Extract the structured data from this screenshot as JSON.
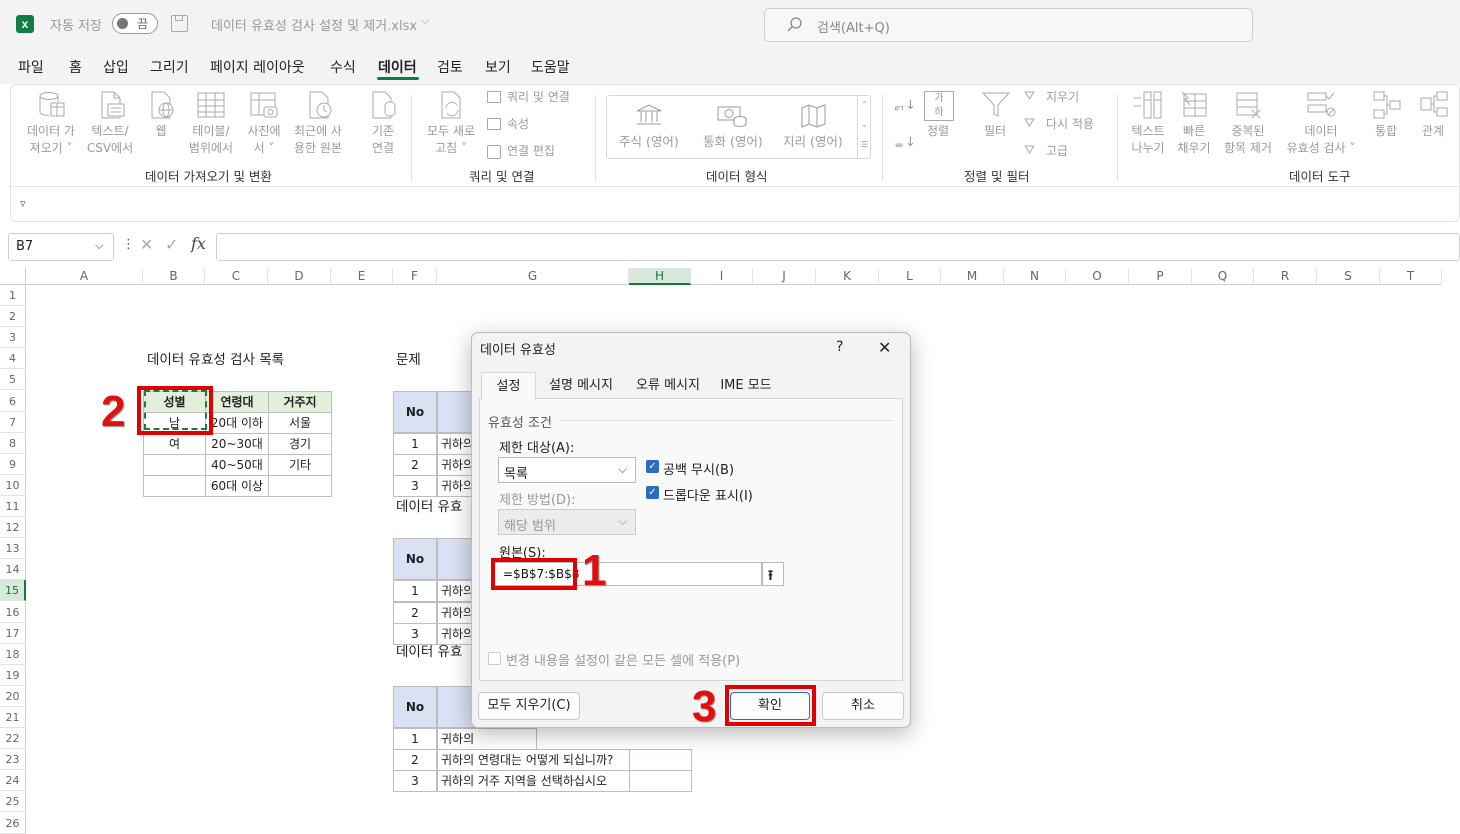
{
  "titlebar": {
    "autosave_label": "자동 저장",
    "toggle_label": "끔",
    "filename": "데이터 유효성 검사 설정 및 제거.xlsx",
    "search_placeholder": "검색(Alt+Q)"
  },
  "menu": [
    "파일",
    "홈",
    "삽입",
    "그리기",
    "페이지 레이아웃",
    "수식",
    "데이터",
    "검토",
    "보기",
    "도움말"
  ],
  "ribbon": {
    "get_data_1": "데이터 가",
    "get_data_2": "져오기 ˅",
    "text_csv_1": "텍스트/",
    "text_csv_2": "CSV에서",
    "web": "웹",
    "table_1": "테이블/",
    "table_2": "범위에서",
    "picture_1": "사진에",
    "picture_2": "서 ˅",
    "recent_1": "최근에 사",
    "recent_2": "용한 원본",
    "existing_1": "기존",
    "existing_2": "연결",
    "refresh_1": "모두 새로",
    "refresh_2": "고침 ˅",
    "queries": "쿼리 및 연결",
    "properties": "속성",
    "edit_links": "연결 편집",
    "stocks": "주식 (영어)",
    "currency": "통화 (영어)",
    "geo": "지리 (영어)",
    "sort": "정렬",
    "filter": "필터",
    "clear": "지우기",
    "reapply": "다시 적용",
    "advanced": "고급",
    "text_col_1": "텍스트",
    "text_col_2": "나누기",
    "flash_1": "빠른",
    "flash_2": "채우기",
    "dup_1": "중복된",
    "dup_2": "항목 제거",
    "valid_1": "데이터",
    "valid_2": "유효성 검사 ˅",
    "consolidate": "통합",
    "relations": "관계",
    "grp_get": "데이터 가져오기 및 변환",
    "grp_query": "쿼리 및 연결",
    "grp_types": "데이터 형식",
    "grp_sort": "정렬 및 필터",
    "grp_tools": "데이터 도구"
  },
  "formula_bar": {
    "name_box": "B7",
    "fx": "fx",
    "value": ""
  },
  "columns": [
    "A",
    "B",
    "C",
    "D",
    "E",
    "F",
    "G",
    "H",
    "I",
    "J",
    "K",
    "L",
    "M",
    "N",
    "O",
    "P",
    "Q",
    "R",
    "S",
    "T"
  ],
  "rows": [
    "1",
    "2",
    "3",
    "4",
    "5",
    "6",
    "7",
    "8",
    "9",
    "10",
    "11",
    "12",
    "13",
    "14",
    "15",
    "16",
    "17",
    "18",
    "19",
    "20",
    "21",
    "22",
    "23",
    "24",
    "25",
    "26"
  ],
  "sheet": {
    "list_title": "데이터 유효성 검사 목록",
    "list_headers": [
      "성별",
      "연령대",
      "거주지"
    ],
    "gender": [
      "남",
      "여",
      "",
      ""
    ],
    "age": [
      "20대 이하",
      "20~30대",
      "40~50대",
      "60대 이상"
    ],
    "region": [
      "서울",
      "경기",
      "기타",
      ""
    ],
    "problem_title": "문제",
    "validation_title_2": "데이터 유효",
    "validation_title_3": "데이터 유효",
    "no_label": "No",
    "nums": [
      "1",
      "2",
      "3"
    ],
    "q_partial": "귀하의",
    "q2": "귀하의 연령대는 어떻게 되십니까?",
    "q3": "귀하의 거주 지역을 선택하십시오"
  },
  "dialog": {
    "title": "데이터 유효성",
    "help": "?",
    "close": "✕",
    "tabs": [
      "설정",
      "설명 메시지",
      "오류 메시지",
      "IME 모드"
    ],
    "criteria_label": "유효성 조건",
    "allow_label": "제한 대상(A):",
    "allow_value": "목록",
    "ignore_blank": "공백 무시(B)",
    "dropdown": "드롭다운 표시(I)",
    "data_label": "제한 방법(D):",
    "data_value": "해당 범위",
    "source_label": "원본(S):",
    "source_value": "=$B$7:$B$8",
    "apply_all": "변경 내용을 설정이 같은 모든 셀에 적용(P)",
    "clear_all": "모두 지우기(C)",
    "ok": "확인",
    "cancel": "취소"
  },
  "annotations": {
    "n1": "1",
    "n2": "2",
    "n3": "3"
  },
  "colors": {
    "excel_green": "#107c41",
    "header_fill": "#e2efda",
    "blue_fill": "#d9e1f2",
    "annotation_red": "#e00000"
  }
}
